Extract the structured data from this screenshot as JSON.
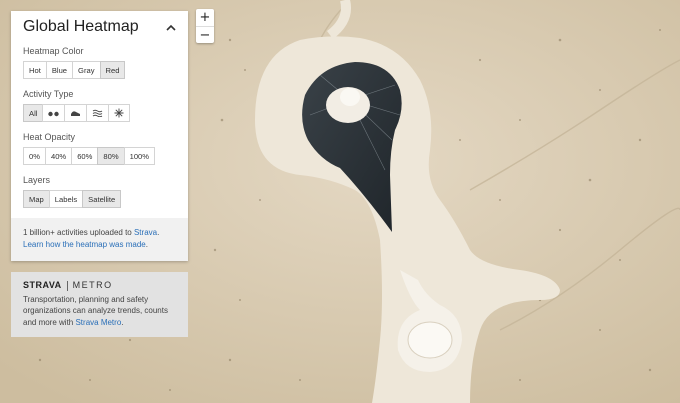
{
  "panel": {
    "title": "Global Heatmap",
    "sections": {
      "color": {
        "label": "Heatmap Color",
        "options": [
          "Hot",
          "Blue",
          "Gray",
          "Red"
        ],
        "selected": "Red"
      },
      "activity": {
        "label": "Activity Type",
        "options": [
          {
            "label": "All",
            "icon": null
          },
          {
            "label": "",
            "icon": "bike-icon"
          },
          {
            "label": "",
            "icon": "run-icon"
          },
          {
            "label": "",
            "icon": "water-icon"
          },
          {
            "label": "",
            "icon": "winter-icon"
          }
        ],
        "selected": "All"
      },
      "opacity": {
        "label": "Heat Opacity",
        "options": [
          "0%",
          "40%",
          "60%",
          "80%",
          "100%"
        ],
        "selected": "80%"
      },
      "layers": {
        "label": "Layers",
        "options": [
          "Map",
          "Labels",
          "Satellite"
        ],
        "selected": "Map"
      }
    },
    "info": {
      "text_before": "1 billion+ activities uploaded to ",
      "strava_link": "Strava",
      "text_after": ".",
      "learn_link": "Learn how the heatmap was made",
      "learn_after": "."
    }
  },
  "metro": {
    "logo_strava": "STRAVA",
    "logo_metro": "METRO",
    "text": "Transportation, planning and safety organizations can analyze trends, counts and more with ",
    "link": "Strava Metro",
    "after": "."
  },
  "zoom": {
    "in": "+",
    "out": "−"
  },
  "colors": {
    "accent_link": "#2a6fb8",
    "panel_bg": "#ffffff",
    "info_bg": "#f1f1f1",
    "metro_bg": "#e2e2e2"
  }
}
